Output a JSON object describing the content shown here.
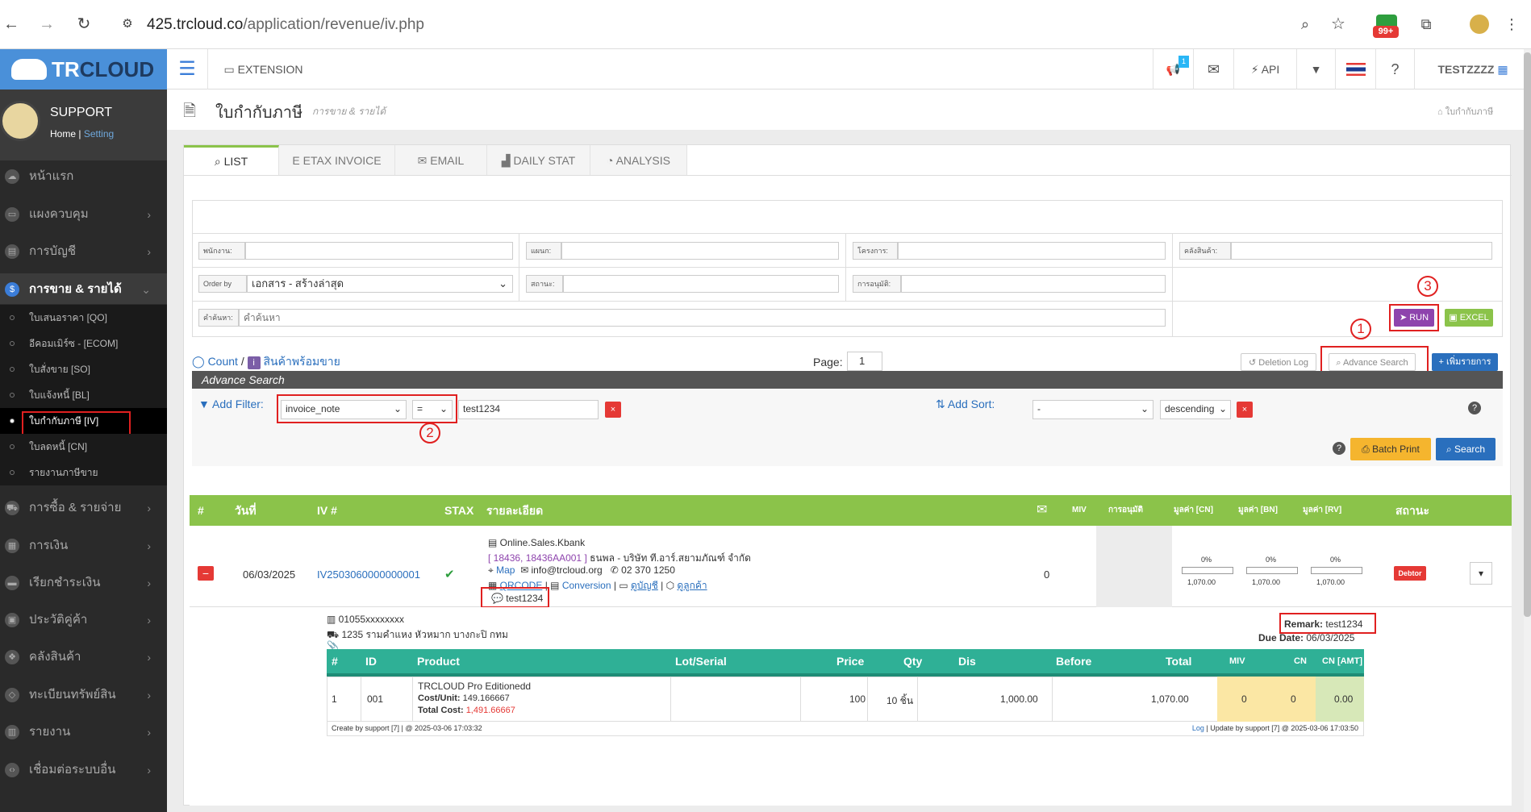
{
  "browser": {
    "url_domain": "425.trcloud.co",
    "url_path": "/application/revenue/iv.php",
    "badge": "99+"
  },
  "sidebar": {
    "brand_tr": "TR",
    "brand_cloud": "CLOUD",
    "user_name": "SUPPORT",
    "home_link": "Home",
    "separator": "|",
    "setting_link": "Setting",
    "menu": [
      {
        "label": "หน้าแรก"
      },
      {
        "label": "แผงควบคุม"
      },
      {
        "label": "การบัญชี"
      },
      {
        "label": "การขาย & รายได้"
      },
      {
        "label": "การซื้อ & รายจ่าย"
      },
      {
        "label": "การเงิน"
      },
      {
        "label": "เรียกชำระเงิน"
      },
      {
        "label": "ประวัติคู่ค้า"
      },
      {
        "label": "คลังสินค้า"
      },
      {
        "label": "ทะเบียนทรัพย์สิน"
      },
      {
        "label": "รายงาน"
      },
      {
        "label": "เชื่อมต่อระบบอื่น"
      }
    ],
    "submenu": [
      {
        "label": "ใบเสนอราคา [QO]"
      },
      {
        "label": "อีคอมเมิร์ซ - [ECOM]"
      },
      {
        "label": "ใบสั่งขาย [SO]"
      },
      {
        "label": "ใบแจ้งหนี้ [BL]"
      },
      {
        "label": "ใบกำกับภาษี [IV]"
      },
      {
        "label": "ใบลดหนี้ [CN]"
      },
      {
        "label": "รายงานภาษีขาย"
      }
    ]
  },
  "topbar": {
    "extension": "EXTENSION",
    "notif_badge": "1",
    "api": "API",
    "user": "TESTZZZZ"
  },
  "page": {
    "title": "ใบกำกับภาษี",
    "subtitle": "การขาย & รายได้",
    "breadcrumb": "ใบกำกับภาษี"
  },
  "tabs": [
    {
      "label": "LIST"
    },
    {
      "label": "ETAX INVOICE"
    },
    {
      "label": "EMAIL"
    },
    {
      "label": "DAILY STAT"
    },
    {
      "label": "ANALYSIS"
    }
  ],
  "filters": {
    "employee_label": "พนักงาน:",
    "dept_label": "แผนก:",
    "project_label": "โครงการ:",
    "warehouse_label": "คลังสินค้า:",
    "orderby_label": "Order by",
    "orderby_value": "เอกสาร - สร้างล่าสุด",
    "status_label": "สถานะ:",
    "approval_label": "การอนุมัติ:",
    "search_label": "คำค้นหา:",
    "search_placeholder": "คำค้นหา",
    "run": "RUN",
    "excel": "EXCEL"
  },
  "annotations": {
    "one": "1",
    "two": "2",
    "three": "3"
  },
  "toolbar": {
    "count": "Count",
    "slash": "/",
    "ready_stock": "สินค้าพร้อมขาย",
    "page_label": "Page:",
    "page_value": "1",
    "deletion_log": "Deletion Log",
    "advance_search": "Advance Search",
    "add_item": "เพิ่มรายการ"
  },
  "advance": {
    "header": "Advance Search",
    "add_filter": "Add Filter:",
    "filter_field": "invoice_note",
    "filter_op": "=",
    "filter_value": "test1234",
    "add_sort": "Add Sort:",
    "sort_field": "-",
    "sort_dir": "descending",
    "help": "?",
    "batch_print": "Batch Print",
    "search": "Search",
    "remove": "×"
  },
  "grid": {
    "headers": {
      "no": "#",
      "date": "วันที่",
      "iv": "IV #",
      "stax": "STAX",
      "detail": "รายละเอียด",
      "miv": "MIV",
      "approval": "การอนุมัติ",
      "cn": "มูลค่า [CN]",
      "bn": "มูลค่า [BN]",
      "rv": "มูลค่า [RV]",
      "status": "สถานะ"
    },
    "row": {
      "minus": "−",
      "date": "06/03/2025",
      "iv_no": "IV2503060000000001",
      "stax_check": "✔",
      "channel": "Online.Sales.Kbank",
      "codes": "[ 18436, 18436AA001 ]",
      "customer": "ธนพล - บริษัท ที.อาร์.สยามภัณฑ์ จำกัด",
      "map": "Map",
      "email": "info@trcloud.org",
      "phone": "02 370 1250",
      "qrcode": "QRCODE",
      "conversion": "Conversion",
      "view_account": "ดูบัญชี",
      "view_customer": "ดูลูกค้า",
      "note": "test1234",
      "miv_count": "0",
      "cn_pct": "0%",
      "bn_pct": "0%",
      "rv_pct": "0%",
      "cn_amt": "1,070.00",
      "bn_amt": "1,070.00",
      "rv_amt": "1,070.00",
      "cn_fill": 0,
      "bn_fill": 0,
      "rv_fill": 0,
      "status": "Debtor",
      "caret": "▾"
    }
  },
  "detail": {
    "tax_id": "01055xxxxxxxx",
    "address": "1235 รามคำแหง หัวหมาก บางกะปิ กทม",
    "remark_label": "Remark:",
    "remark_value": "test1234",
    "due_label": "Due Date:",
    "due_value": "06/03/2025",
    "item_headers": {
      "no": "#",
      "id": "ID",
      "product": "Product",
      "lot": "Lot/Serial",
      "price": "Price",
      "qty": "Qty",
      "dis": "Dis",
      "before": "Before",
      "total": "Total",
      "miv": "MIV",
      "cn": "CN",
      "cn_amt": "CN [AMT]"
    },
    "item": {
      "no": "1",
      "id": "001",
      "product": "TRCLOUD Pro Editionedd",
      "cost_label": "Cost/Unit:",
      "cost_value": "149.166667",
      "total_cost_label": "Total Cost:",
      "total_cost_value": "1,491.66667",
      "price": "100",
      "qty": "10 ชิ้น",
      "before": "1,000.00",
      "total": "1,070.00",
      "miv": "0",
      "cn": "0",
      "cn_amt": "0.00"
    },
    "footer_left": "Create by support [7] | @ 2025-03-06 17:03:32",
    "footer_log": "Log",
    "footer_right": "| Update by support [7] @ 2025-03-06 17:03:50"
  }
}
